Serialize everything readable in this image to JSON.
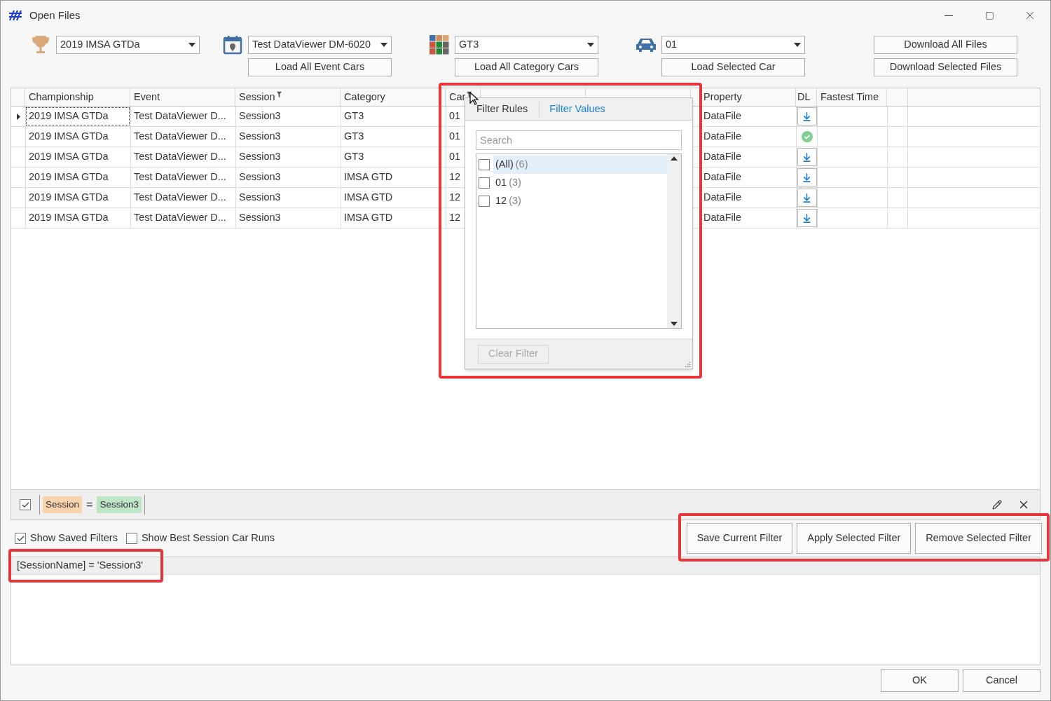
{
  "window": {
    "title": "Open Files"
  },
  "toolbar": {
    "groups": [
      {
        "kind": "trophy",
        "value": "2019 IMSA GTDa"
      },
      {
        "kind": "calendar",
        "value": "Test DataViewer DM-6020",
        "button": "Load All Event Cars"
      },
      {
        "kind": "category",
        "value": "GT3",
        "button": "Load All Category Cars"
      },
      {
        "kind": "car",
        "value": "01",
        "button": "Load Selected Car"
      }
    ],
    "download_buttons": [
      "Download All Files",
      "Download Selected Files"
    ]
  },
  "grid": {
    "columns": [
      {
        "label": "Championship",
        "filtered": false
      },
      {
        "label": "Event",
        "filtered": false
      },
      {
        "label": "Session",
        "filtered": true
      },
      {
        "label": "Category",
        "filtered": false
      },
      {
        "label": "Car",
        "filtered": true
      },
      {},
      {},
      {
        "label": "Property",
        "filtered": false
      },
      {
        "label": "DL",
        "filtered": false
      },
      {
        "label": "Fastest Time",
        "filtered": false
      },
      {
        "filtered": false
      }
    ],
    "rows": [
      {
        "current": true,
        "championship": "2019 IMSA GTDa",
        "event": "Test DataViewer D...",
        "session": "Session3",
        "category": "GT3",
        "car": "01",
        "property": "DataFile",
        "downloaded": false
      },
      {
        "current": false,
        "championship": "2019 IMSA GTDa",
        "event": "Test DataViewer D...",
        "session": "Session3",
        "category": "GT3",
        "car": "01",
        "property": "DataFile",
        "downloaded": true
      },
      {
        "current": false,
        "championship": "2019 IMSA GTDa",
        "event": "Test DataViewer D...",
        "session": "Session3",
        "category": "GT3",
        "car": "01",
        "property": "DataFile",
        "downloaded": false
      },
      {
        "current": false,
        "championship": "2019 IMSA GTDa",
        "event": "Test DataViewer D...",
        "session": "Session3",
        "category": "IMSA GTD",
        "car": "12",
        "property": "DataFile",
        "downloaded": false
      },
      {
        "current": false,
        "championship": "2019 IMSA GTDa",
        "event": "Test DataViewer D...",
        "session": "Session3",
        "category": "IMSA GTD",
        "car": "12",
        "property": "DataFile",
        "downloaded": false
      },
      {
        "current": false,
        "championship": "2019 IMSA GTDa",
        "event": "Test DataViewer D...",
        "session": "Session3",
        "category": "IMSA GTD",
        "car": "12",
        "property": "DataFile",
        "downloaded": false
      }
    ]
  },
  "filter_popup": {
    "tabs": [
      {
        "label": "Filter Rules",
        "selected": false
      },
      {
        "label": "Filter Values",
        "selected": true
      }
    ],
    "search": {
      "placeholder": "Search"
    },
    "values": [
      {
        "label": "(All)",
        "count": "(6)",
        "checked": false,
        "selected": true
      },
      {
        "label": "01",
        "count": "(3)",
        "checked": false,
        "selected": false
      },
      {
        "label": "12",
        "count": "(3)",
        "checked": false,
        "selected": false
      }
    ],
    "clear_button": {
      "label": "Clear Filter",
      "disabled": true
    }
  },
  "filter_bar": {
    "enabled": true,
    "field": "Session",
    "operator": "=",
    "value": "Session3"
  },
  "options": [
    {
      "label": "Show Saved Filters",
      "checked": true
    },
    {
      "label": "Show Best Session Car Runs",
      "checked": false
    }
  ],
  "filter_buttons": [
    "Save Current Filter",
    "Apply Selected Filter",
    "Remove Selected Filter"
  ],
  "saved_filters": [
    {
      "text": "[SessionName] = 'Session3'",
      "selected": true
    }
  ],
  "dialog_buttons": [
    "OK",
    "Cancel"
  ]
}
